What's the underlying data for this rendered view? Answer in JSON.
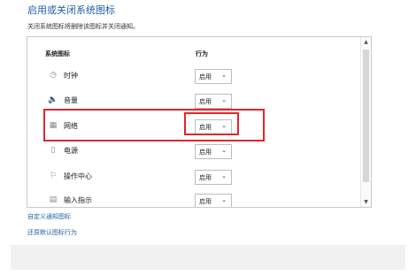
{
  "page": {
    "title": "启用或关闭系统图标",
    "subtitle": "关闭系统图标将删除该图标并关闭通知。"
  },
  "table": {
    "col_icon_header": "系统图标",
    "col_action_header": "行为",
    "rows": [
      {
        "label": "时钟",
        "icon": "clock-icon",
        "glyph": "◷",
        "value": "启用"
      },
      {
        "label": "音量",
        "icon": "volume-icon",
        "glyph": "🔈",
        "value": "启用"
      },
      {
        "label": "网络",
        "icon": "network-icon",
        "glyph": "▦",
        "value": "启用",
        "highlighted": true
      },
      {
        "label": "电源",
        "icon": "power-icon",
        "glyph": "▯",
        "value": "启用"
      },
      {
        "label": "操作中心",
        "icon": "flag-icon",
        "glyph": "⚐",
        "value": "启用"
      },
      {
        "label": "输入指示",
        "icon": "keyboard-icon",
        "glyph": "▤",
        "value": "启用"
      }
    ]
  },
  "links": {
    "customize": "自定义通知图标",
    "restore": "还原默认图标行为"
  },
  "colors": {
    "accent": "#1f5fa8",
    "highlight": "#e2262b"
  }
}
